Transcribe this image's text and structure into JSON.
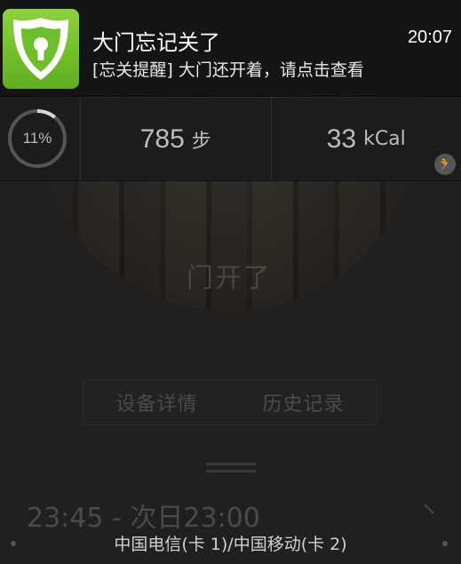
{
  "notification": {
    "title": "大门忘记关了",
    "time": "20:07",
    "text": "[忘关提醒] 大门还开着，请点击查看",
    "icon": "shield-lock-icon",
    "icon_color": "#6cbf2a"
  },
  "stats": {
    "progress_label": "11%",
    "progress_value": 0.11,
    "steps_value": "785",
    "steps_unit": "步",
    "calories_value": "33",
    "calories_unit": "kCal",
    "activity_icon": "runner-icon"
  },
  "device": {
    "door_status": "门开了",
    "buttons": {
      "details": "设备详情",
      "history": "历史记录"
    },
    "schedule": "23:45 - 次日23:00"
  },
  "status_bar": {
    "carrier": "中国电信(卡 1)/中国移动(卡 2)"
  }
}
